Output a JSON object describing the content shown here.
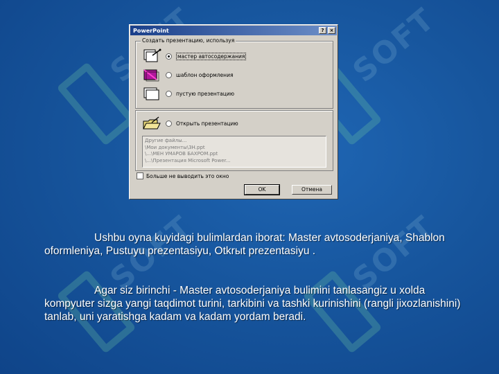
{
  "dialog": {
    "title": "PowerPoint",
    "help_btn": "?",
    "close_btn": "×",
    "group_label": "Создать презентацию, используя",
    "options": [
      {
        "label": "мастер автосодержания",
        "selected": true,
        "icon": "wizard-icon"
      },
      {
        "label": "шаблон оформления",
        "selected": false,
        "icon": "template-icon"
      },
      {
        "label": "пустую презентацию",
        "selected": false,
        "icon": "blank-presentation-icon"
      }
    ],
    "open_option": {
      "label": "Открыть презентацию",
      "selected": false,
      "icon": "open-folder-icon"
    },
    "recent_files": [
      "Другие файлы...",
      "\\Мои документы\\3Н.ppt",
      "\\...\\МЕН УМАРОВ БАХРОМ.ppt",
      "\\...\\Презентация Microsoft Power..."
    ],
    "checkbox_label": "Больше не выводить это окно",
    "ok_label": "OK",
    "cancel_label": "Отмена"
  },
  "body": {
    "paragraph1": "Ushbu oyna kuyidagi bulimlardan iborat: Master avtosoderjaniya, Shablon oformleniya, Pustuyu prezentasiyu, Otkrыt prezentasiyu .",
    "paragraph2": "Agar siz birinchi - Master avtosoderjaniya bulimini tanlasangiz u xolda kompyuter sizga yangi taqdimot turini, tarkibini va tashki kurinishini (rangli jixozlanishini) tanlab, uni yaratishga kadam va kadam yordam beradi."
  },
  "watermark": {
    "text": "SOFT"
  },
  "colors": {
    "background": "#17569e",
    "titlebar": "#1a3f8a",
    "dialog": "#d4d0c8"
  }
}
